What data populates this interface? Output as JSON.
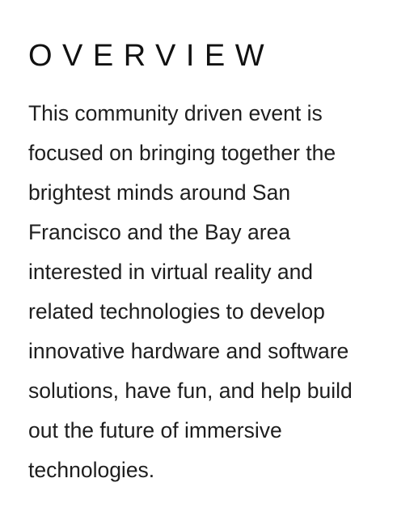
{
  "overview": {
    "heading": "OVERVIEW",
    "paragraph": "This community driven event is focused on bringing together the brightest minds around San Francisco and the Bay area interested in virtual reality and related technologies to develop innovative hardware and software solutions, have fun, and help build out the future of immersive technologies."
  }
}
